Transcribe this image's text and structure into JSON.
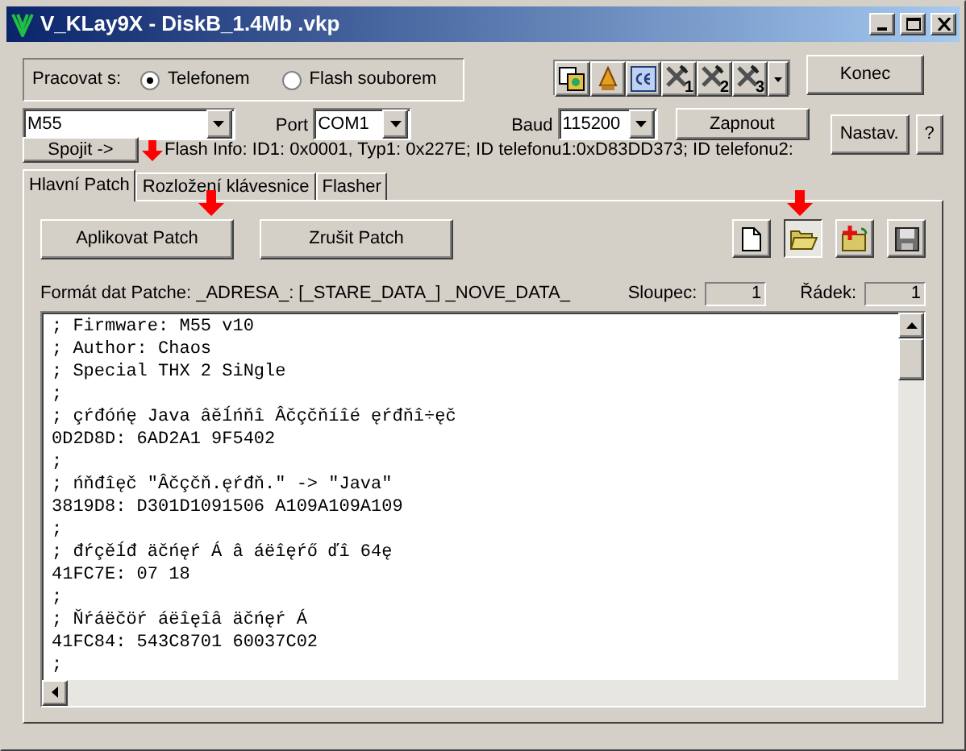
{
  "window": {
    "title": "V_KLay9X - DiskB_1.4Mb .vkp"
  },
  "mode": {
    "label": "Pracovat s:",
    "options": [
      {
        "label": "Telefonem",
        "selected": true
      },
      {
        "label": "Flash souborem",
        "selected": false
      }
    ]
  },
  "toolbar": [
    {
      "kind": "abc"
    },
    {
      "kind": "bell"
    },
    {
      "kind": "ce"
    },
    {
      "kind": "tool",
      "label": "1"
    },
    {
      "kind": "tool",
      "label": "2"
    },
    {
      "kind": "tool",
      "label": "3"
    },
    {
      "kind": "dropdown"
    }
  ],
  "quit": "Konec",
  "phone": {
    "value": "M55"
  },
  "port": {
    "label": "Port",
    "value": "COM1"
  },
  "baud": {
    "label": "Baud",
    "value": "115200"
  },
  "power": "Zapnout",
  "settings": "Nastav.",
  "help": "?",
  "connect": "Spojit ->",
  "flash_info": "Flash Info: ID1: 0x0001, Typ1: 0x227E; ID telefonu1:0xD83DD373; ID telefonu2:",
  "tabs": [
    {
      "label": "Hlavní Patch",
      "selected": true
    },
    {
      "label": "Rozložení klávesnice",
      "selected": false
    },
    {
      "label": "Flasher",
      "selected": false
    }
  ],
  "actions": [
    "Aplikovat Patch",
    "Zrušit Patch"
  ],
  "file_buttons": [
    {
      "kind": "new",
      "pressed": false
    },
    {
      "kind": "open",
      "pressed": true
    },
    {
      "kind": "add",
      "pressed": false
    },
    {
      "kind": "save",
      "pressed": false
    }
  ],
  "format": "Formát dat Patche: _ADRESA_: [_STARE_DATA_] _NOVE_DATA_",
  "column": {
    "label": "Sloupec:",
    "value": "1"
  },
  "row": {
    "label": "Řádek:",
    "value": "1"
  },
  "editor_lines": [
    "; Firmware: M55 v10",
    "; Author: Chaos",
    "; Special THX 2 SiNgle",
    ";",
    "; çŕđóńę Java âěĺńňî Âčçčňíîé ęŕđňî÷ęč",
    "0D2D8D: 6AD2A1 9F5402",
    ";",
    "; ńňđîęč \"Âčçčň.ęŕđň.\" -> \"Java\"",
    "3819D8: D301D1091506 A109A109A109",
    ";",
    "; đŕçěĺđ äčńęŕ Á â áëîęŕő ďî 64ę",
    "41FC7E: 07 18",
    ";",
    "; Ňŕáëčöŕ áëîęîâ äčńęŕ Á",
    "41FC84: 543C8701 60037C02",
    ";"
  ]
}
